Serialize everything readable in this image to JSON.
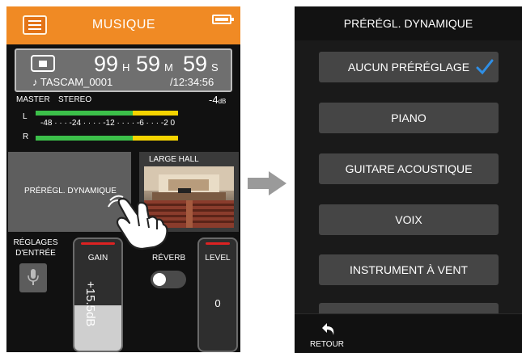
{
  "left_screen": {
    "header": {
      "title": "MUSIQUE"
    },
    "time_display": {
      "hours": "99",
      "hours_unit": "H",
      "minutes": "59",
      "minutes_unit": "M",
      "seconds": "59",
      "seconds_unit": "S",
      "filename": "♪ TASCAM_0001",
      "total": "/12:34:56"
    },
    "meter": {
      "master_label": "MASTER",
      "mode_label": "STEREO",
      "peak_value": "-4",
      "peak_unit": "dB",
      "channel_l": "L",
      "channel_r": "R",
      "scale": "-48 · · · -24 · · · · -12 · · · · -6 · · · -2 0"
    },
    "preset": {
      "label": "PRÉRÉGL. DYNAMIQUE"
    },
    "reverb_type": {
      "label": "LARGE HALL"
    },
    "input_settings": {
      "line1": "RÉGLAGES",
      "line2": "D'ENTRÉE"
    },
    "gain": {
      "label": "GAIN",
      "value": "+15.5dB"
    },
    "reverb": {
      "label": "RÉVERB",
      "state": "off"
    },
    "level": {
      "label": "LEVEL",
      "value": "0"
    },
    "colors": {
      "accent": "#f08a24",
      "meter_green": "#3cc04a",
      "meter_yellow": "#f5d400"
    }
  },
  "right_screen": {
    "title": "PRÉRÉGL. DYNAMIQUE",
    "options": [
      {
        "label": "AUCUN PRÉRÉGLAGE",
        "selected": true
      },
      {
        "label": "PIANO",
        "selected": false
      },
      {
        "label": "GUITARE ACOUSTIQUE",
        "selected": false
      },
      {
        "label": "VOIX",
        "selected": false
      },
      {
        "label": "INSTRUMENT À VENT",
        "selected": false
      }
    ],
    "back_label": "RETOUR",
    "check_color": "#2f8fe6"
  }
}
